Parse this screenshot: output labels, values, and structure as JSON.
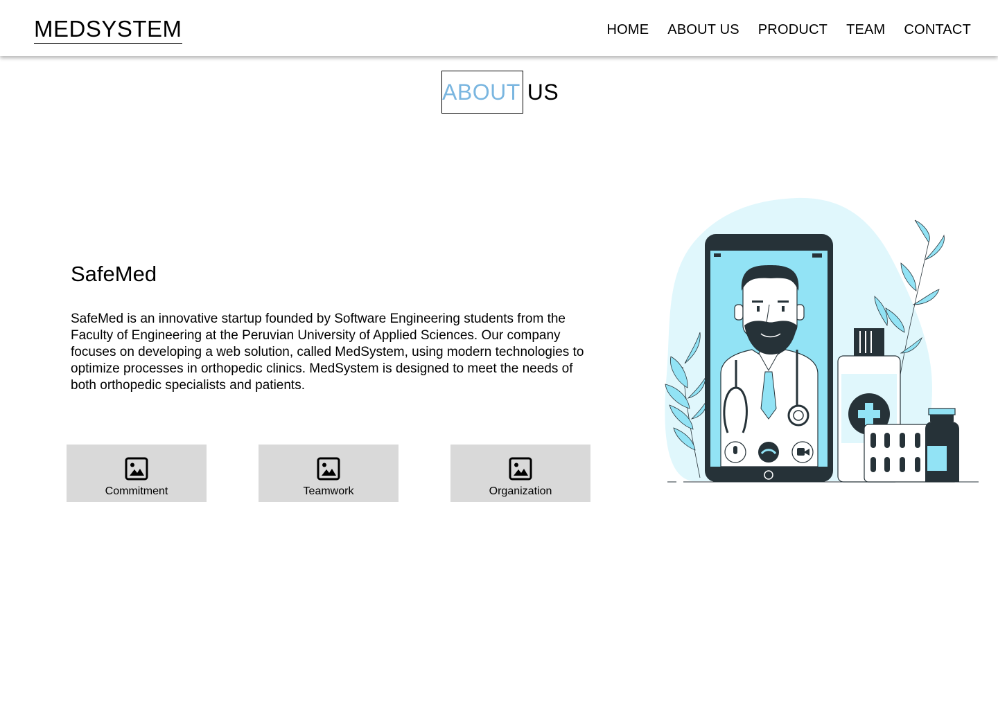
{
  "header": {
    "logo": "MEDSYSTEM",
    "nav": [
      "HOME",
      "ABOUT US",
      "PRODUCT",
      "TEAM",
      "CONTACT"
    ]
  },
  "section": {
    "title_highlight": "ABOUT",
    "title_rest": "US"
  },
  "company": {
    "name": "SafeMed",
    "description": "SafeMed is an innovative startup founded by Software Engineering students from the Faculty of Engineering at the Peruvian University of Applied Sciences. Our company focuses on developing a web solution, called MedSystem, using modern technologies to optimize processes in orthopedic clinics. MedSystem is designed to meet the needs of both orthopedic specialists and patients."
  },
  "values": [
    {
      "label": "Commitment",
      "icon": "image-icon"
    },
    {
      "label": "Teamwork",
      "icon": "image-icon"
    },
    {
      "label": "Organization",
      "icon": "image-icon"
    }
  ],
  "colors": {
    "accent": "#7ab6e0",
    "card_bg": "#d9d9d9",
    "illustration_cyan": "#92e3f5",
    "illustration_dark": "#263238"
  }
}
